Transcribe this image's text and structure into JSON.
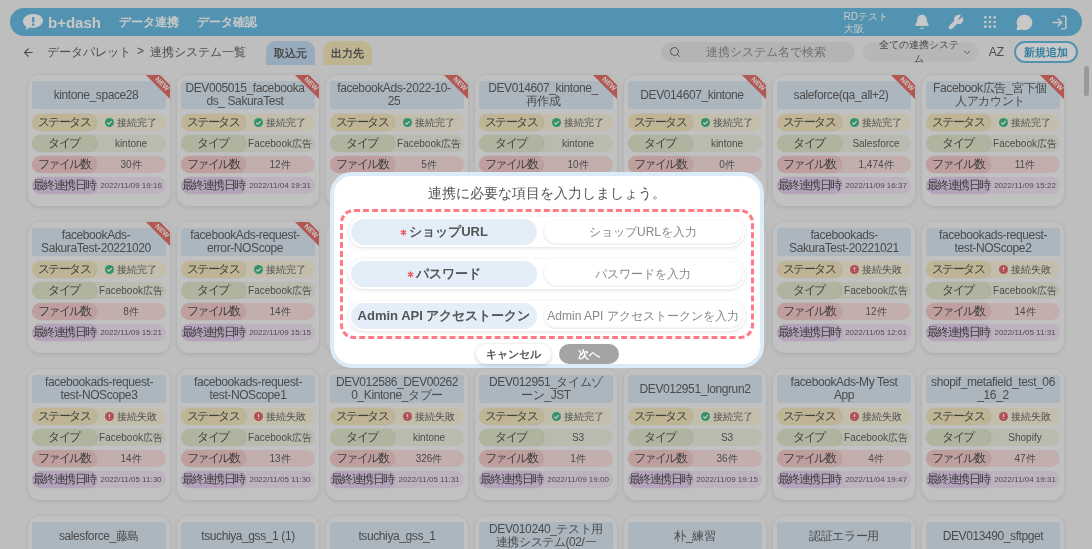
{
  "header": {
    "logo": "b+dash",
    "nav": [
      "データ連携",
      "データ確認"
    ],
    "user": {
      "name": "RDテスト",
      "place": "大阪"
    }
  },
  "toolbar": {
    "breadcrumb": [
      "データパレット",
      ">",
      "連携システム一覧"
    ],
    "tabs": [
      {
        "label": "取込元",
        "selected": true
      },
      {
        "label": "出力先",
        "selected": false
      }
    ],
    "search": {
      "placeholder": "連携システム名で検索"
    },
    "filter": "全ての連携システム",
    "sort": "AZ",
    "add_button": "新規追加"
  },
  "card_rows": [
    {
      "cards": [
        {
          "kind": "card",
          "title": "kintone_space28",
          "badge": "NEW",
          "fields": [
            {
              "kind": "status",
              "label": "ステータス",
              "value": "接続完了",
              "ok": true
            },
            {
              "kind": "type",
              "label": "タイプ",
              "value": "kintone"
            },
            {
              "kind": "files",
              "label": "ファイル数",
              "value": "30件"
            },
            {
              "kind": "date",
              "label": "最終連携日時",
              "value": "2022/11/09 19:16"
            }
          ]
        },
        {
          "kind": "card",
          "title": "DEV005015_facebookads_ SakuraTest",
          "badge": "NEW",
          "fields": [
            {
              "kind": "status",
              "label": "ステータス",
              "value": "接続完了",
              "ok": true
            },
            {
              "kind": "type",
              "label": "タイプ",
              "value": "Facebook広告"
            },
            {
              "kind": "files",
              "label": "ファイル数",
              "value": "12件"
            },
            {
              "kind": "date",
              "label": "最終連携日時",
              "value": "2022/11/04 19:31"
            }
          ]
        },
        {
          "kind": "card",
          "title": "facebookAds-2022-10-25",
          "badge": "NEW",
          "fields": [
            {
              "kind": "status",
              "label": "ステータス",
              "value": "接続完了",
              "ok": true
            },
            {
              "kind": "type",
              "label": "タイプ",
              "value": "Facebook広告"
            },
            {
              "kind": "files",
              "label": "ファイル数",
              "value": "5件"
            }
          ]
        },
        {
          "kind": "card",
          "title": "DEV014607_kintone_再作成",
          "badge": "NEW",
          "fields": [
            {
              "kind": "status",
              "label": "ステータス",
              "value": "接続完了",
              "ok": true
            },
            {
              "kind": "type",
              "label": "タイプ",
              "value": "kintone"
            },
            {
              "kind": "files",
              "label": "ファイル数",
              "value": "10件"
            }
          ]
        },
        {
          "kind": "card",
          "title": "DEV014607_kintone",
          "badge": "NEW",
          "fields": [
            {
              "kind": "status",
              "label": "ステータス",
              "value": "接続完了",
              "ok": true
            },
            {
              "kind": "type",
              "label": "タイプ",
              "value": "kintone"
            },
            {
              "kind": "files",
              "label": "ファイル数",
              "value": "0件"
            }
          ]
        },
        {
          "kind": "card",
          "title": "saleforce(qa_all+2)",
          "badge": "NEW",
          "fields": [
            {
              "kind": "status",
              "label": "ステータス",
              "value": "接続完了",
              "ok": true
            },
            {
              "kind": "type",
              "label": "タイプ",
              "value": "Salesforce"
            },
            {
              "kind": "files",
              "label": "ファイル数",
              "value": "1,474件"
            },
            {
              "kind": "date",
              "label": "最終連携日時",
              "value": "2022/11/09 16:37"
            }
          ]
        },
        {
          "kind": "card",
          "title": "Facebook広告_宮下個人アカウント",
          "badge": "NEW",
          "fields": [
            {
              "kind": "status",
              "label": "ステータス",
              "value": "接続完了",
              "ok": true
            },
            {
              "kind": "type",
              "label": "タイプ",
              "value": "Facebook広告"
            },
            {
              "kind": "files",
              "label": "ファイル数",
              "value": "11件"
            },
            {
              "kind": "date",
              "label": "最終連携日時",
              "value": "2022/11/09 15:22"
            }
          ]
        }
      ]
    },
    {
      "cards": [
        {
          "kind": "card",
          "title": "facebookAds-SakuraTest-20221020",
          "badge": "NEW",
          "fields": [
            {
              "kind": "status",
              "label": "ステータス",
              "value": "接続完了",
              "ok": true
            },
            {
              "kind": "type",
              "label": "タイプ",
              "value": "Facebook広告"
            },
            {
              "kind": "files",
              "label": "ファイル数",
              "value": "8件"
            },
            {
              "kind": "date",
              "label": "最終連携日時",
              "value": "2022/11/09 15:21"
            }
          ]
        },
        {
          "kind": "card",
          "title": "facebookAds-request-error-NOScope",
          "badge": "NEW",
          "fields": [
            {
              "kind": "status",
              "label": "ステータス",
              "value": "接続完了",
              "ok": true
            },
            {
              "kind": "type",
              "label": "タイプ",
              "value": "Facebook広告"
            },
            {
              "kind": "files",
              "label": "ファイル数",
              "value": "14件"
            },
            {
              "kind": "date",
              "label": "最終連携日時",
              "value": "2022/11/09 15:15"
            }
          ]
        },
        {
          "kind": "covered"
        },
        {
          "kind": "covered"
        },
        {
          "kind": "covered"
        },
        {
          "kind": "card",
          "title": "facebookads-SakuraTest-20221021",
          "fields": [
            {
              "kind": "status",
              "label": "ステータス",
              "value": "接続失敗",
              "ok": false
            },
            {
              "kind": "type",
              "label": "タイプ",
              "value": "Facebook広告"
            },
            {
              "kind": "files",
              "label": "ファイル数",
              "value": "12件"
            },
            {
              "kind": "date",
              "label": "最終連携日時",
              "value": "2022/11/05 12:01"
            }
          ]
        },
        {
          "kind": "card",
          "title": "facebookads-request-test-NOScope2",
          "fields": [
            {
              "kind": "status",
              "label": "ステータス",
              "value": "接続失敗",
              "ok": false
            },
            {
              "kind": "type",
              "label": "タイプ",
              "value": "Facebook広告"
            },
            {
              "kind": "files",
              "label": "ファイル数",
              "value": "14件"
            },
            {
              "kind": "date",
              "label": "最終連携日時",
              "value": "2022/11/05 11:31"
            }
          ]
        }
      ]
    },
    {
      "cards": [
        {
          "kind": "card",
          "title": "facebookads-request-test-NOScope3",
          "fields": [
            {
              "kind": "status",
              "label": "ステータス",
              "value": "接続失敗",
              "ok": false
            },
            {
              "kind": "type",
              "label": "タイプ",
              "value": "Facebook広告"
            },
            {
              "kind": "files",
              "label": "ファイル数",
              "value": "14件"
            },
            {
              "kind": "date",
              "label": "最終連携日時",
              "value": "2022/11/05 11:30"
            }
          ]
        },
        {
          "kind": "card",
          "title": "facebookads-request-test-NOScope1",
          "fields": [
            {
              "kind": "status",
              "label": "ステータス",
              "value": "接続失敗",
              "ok": false
            },
            {
              "kind": "type",
              "label": "タイプ",
              "value": "Facebook広告"
            },
            {
              "kind": "files",
              "label": "ファイル数",
              "value": "13件"
            },
            {
              "kind": "date",
              "label": "最終連携日時",
              "value": "2022/11/05 11:30"
            }
          ]
        },
        {
          "kind": "card",
          "title": "DEV012586_DEV002620_Kintone_タブー",
          "fields": [
            {
              "kind": "status",
              "label": "ステータス",
              "value": "接続失敗",
              "ok": false
            },
            {
              "kind": "type",
              "label": "タイプ",
              "value": "kintone"
            },
            {
              "kind": "files",
              "label": "ファイル数",
              "value": "326件"
            },
            {
              "kind": "date",
              "label": "最終連携日時",
              "value": "2022/11/05 11:31"
            }
          ]
        },
        {
          "kind": "card",
          "title": "DEV012951_タイムゾーン_JST",
          "fields": [
            {
              "kind": "status",
              "label": "ステータス",
              "value": "接続完了",
              "ok": true
            },
            {
              "kind": "type",
              "label": "タイプ",
              "value": "S3"
            },
            {
              "kind": "files",
              "label": "ファイル数",
              "value": "1件"
            },
            {
              "kind": "date",
              "label": "最終連携日時",
              "value": "2022/11/09 19:00"
            }
          ]
        },
        {
          "kind": "card",
          "title": "DEV012951_longrun2",
          "fields": [
            {
              "kind": "status",
              "label": "ステータス",
              "value": "接続完了",
              "ok": true
            },
            {
              "kind": "type",
              "label": "タイプ",
              "value": "S3"
            },
            {
              "kind": "files",
              "label": "ファイル数",
              "value": "36件"
            },
            {
              "kind": "date",
              "label": "最終連携日時",
              "value": "2022/11/09 19:15"
            }
          ]
        },
        {
          "kind": "card",
          "title": "facebookAds-My Test App",
          "fields": [
            {
              "kind": "status",
              "label": "ステータス",
              "value": "接続失敗",
              "ok": false
            },
            {
              "kind": "type",
              "label": "タイプ",
              "value": "Facebook広告"
            },
            {
              "kind": "files",
              "label": "ファイル数",
              "value": "4件"
            },
            {
              "kind": "date",
              "label": "最終連携日時",
              "value": "2022/11/04 19:47"
            }
          ]
        },
        {
          "kind": "card",
          "title": "shopif_metafield_test_06_16_2",
          "fields": [
            {
              "kind": "status",
              "label": "ステータス",
              "value": "接続失敗",
              "ok": false
            },
            {
              "kind": "type",
              "label": "タイプ",
              "value": "Shopify"
            },
            {
              "kind": "files",
              "label": "ファイル数",
              "value": "47件"
            },
            {
              "kind": "date",
              "label": "最終連携日時",
              "value": "2022/11/04 19:31"
            }
          ]
        }
      ]
    },
    {
      "cards": [
        {
          "kind": "card",
          "title": "salesforce_藤島"
        },
        {
          "kind": "card",
          "title": "tsuchiya_gss_1 (1)"
        },
        {
          "kind": "card",
          "title": "tsuchiya_gss_1"
        },
        {
          "kind": "card",
          "title": "DEV010240_テスト用連携システム(02/一"
        },
        {
          "kind": "card",
          "title": "朴_練習"
        },
        {
          "kind": "card",
          "title": "認証エラー用"
        },
        {
          "kind": "card",
          "title": "DEV013490_sftpget"
        }
      ]
    }
  ],
  "modal": {
    "title": "連携に必要な項目を入力しましょう。",
    "fields": [
      {
        "label": "ショップURL",
        "required": true,
        "placeholder": "ショップURLを入力"
      },
      {
        "label": "パスワード",
        "required": true,
        "placeholder": "パスワードを入力"
      },
      {
        "label": "Admin API アクセストークン",
        "required": false,
        "placeholder": "Admin API アクセストークンを入力"
      }
    ],
    "buttons": [
      {
        "label": "キャンセル",
        "disabled": false
      },
      {
        "label": "次へ",
        "disabled": true
      }
    ]
  }
}
